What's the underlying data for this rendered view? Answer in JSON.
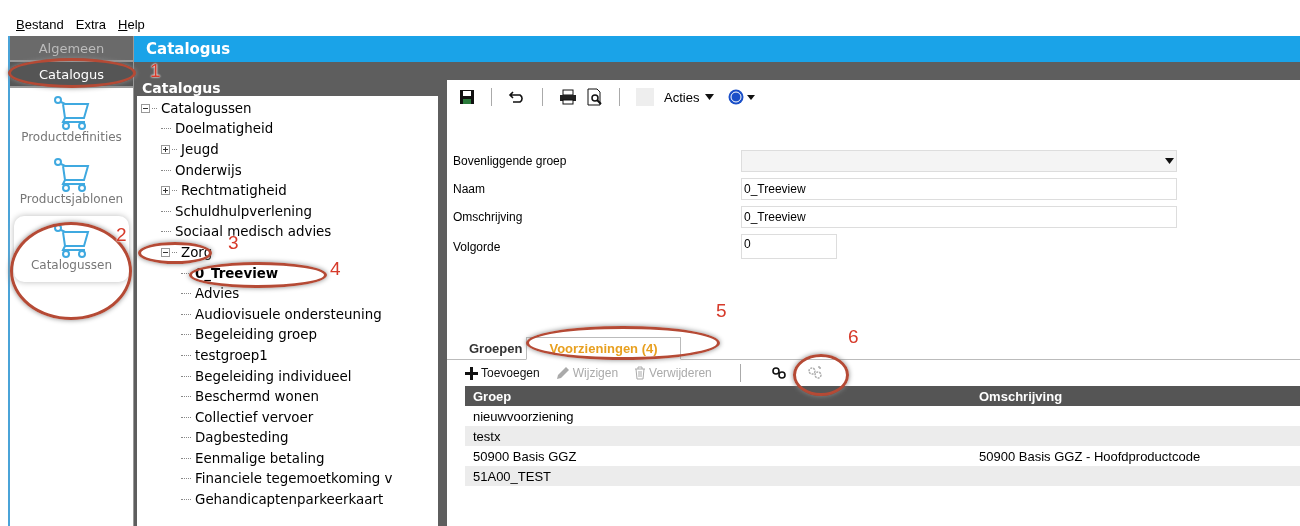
{
  "menu": [
    {
      "label": "Bestand",
      "mnemonic": true
    },
    {
      "label": "Extra",
      "mnemonic": false
    },
    {
      "label": "Help",
      "mnemonic": true
    }
  ],
  "sidebar": {
    "tabs": [
      {
        "label": "Algemeen",
        "selected": false
      },
      {
        "label": "Catalogus",
        "selected": true
      }
    ],
    "items": [
      {
        "label": "Productdefinities",
        "selected": false
      },
      {
        "label": "Productsjablonen",
        "selected": false
      },
      {
        "label": "Catalogussen",
        "selected": true
      }
    ]
  },
  "header": {
    "title": "Catalogus"
  },
  "tree": {
    "title": "Catalogus",
    "items": [
      {
        "label": "Catalogussen",
        "expanded": true,
        "selected": false,
        "children": [
          {
            "label": "Doelmatigheid",
            "selected": false
          },
          {
            "label": "Jeugd",
            "expanded": false,
            "selected": false
          },
          {
            "label": "Onderwijs",
            "selected": false
          },
          {
            "label": "Rechtmatigheid",
            "expanded": false,
            "selected": false
          },
          {
            "label": "Schuldhulpverlening",
            "selected": false
          },
          {
            "label": "Sociaal medisch advies",
            "selected": false
          },
          {
            "label": "Zorg",
            "expanded": true,
            "selected": false,
            "children": [
              {
                "label": "0_Treeview",
                "selected": true
              },
              {
                "label": "Advies",
                "selected": false
              },
              {
                "label": "Audiovisuele ondersteuning",
                "selected": false
              },
              {
                "label": "Begeleiding groep",
                "selected": false
              },
              {
                "label": "testgroep1",
                "selected": false
              },
              {
                "label": "Begeleiding individueel",
                "selected": false
              },
              {
                "label": "Beschermd wonen",
                "selected": false
              },
              {
                "label": "Collectief vervoer",
                "selected": false
              },
              {
                "label": "Dagbesteding",
                "selected": false
              },
              {
                "label": "Eenmalige betaling",
                "selected": false
              },
              {
                "label": "Financiele tegemoetkoming v",
                "selected": false
              },
              {
                "label": "Gehandicaptenparkeerkaart",
                "selected": false
              }
            ]
          }
        ]
      }
    ]
  },
  "toolbar": {
    "actions_label": "Acties"
  },
  "form": {
    "fields": [
      {
        "label": "Bovenliggende groep",
        "kind": "dropdown"
      },
      {
        "label": "Naam",
        "kind": "text",
        "value": "0_Treeview"
      },
      {
        "label": "Omschrijving",
        "kind": "text",
        "value": "0_Treeview"
      },
      {
        "label": "Volgorde",
        "kind": "number",
        "value": "0"
      }
    ]
  },
  "tabs": [
    {
      "label": "Groepen",
      "selected": false
    },
    {
      "label": "Voorzieningen (4)",
      "selected": true
    }
  ],
  "subtoolbar": {
    "buttons": [
      {
        "label": "Toevoegen",
        "kind": "add",
        "disabled": false
      },
      {
        "label": "Wijzigen",
        "kind": "edit",
        "disabled": true
      },
      {
        "label": "Verwijderen",
        "kind": "delete",
        "disabled": true
      }
    ],
    "icon_buttons": [
      {
        "kind": "link",
        "disabled": false
      },
      {
        "kind": "unlink",
        "disabled": true
      }
    ]
  },
  "table": {
    "columns": [
      "Groep",
      "Omschrijving"
    ],
    "rows": [
      [
        "nieuwvoorziening",
        ""
      ],
      [
        "testx",
        ""
      ],
      [
        "50900 Basis GGZ",
        "50900 Basis GGZ - Hoofdproductcode"
      ],
      [
        "51A00_TEST",
        ""
      ]
    ]
  },
  "annotations": [
    {
      "label": "1"
    },
    {
      "label": "2"
    },
    {
      "label": "3"
    },
    {
      "label": "4"
    },
    {
      "label": "5"
    },
    {
      "label": "6"
    }
  ]
}
